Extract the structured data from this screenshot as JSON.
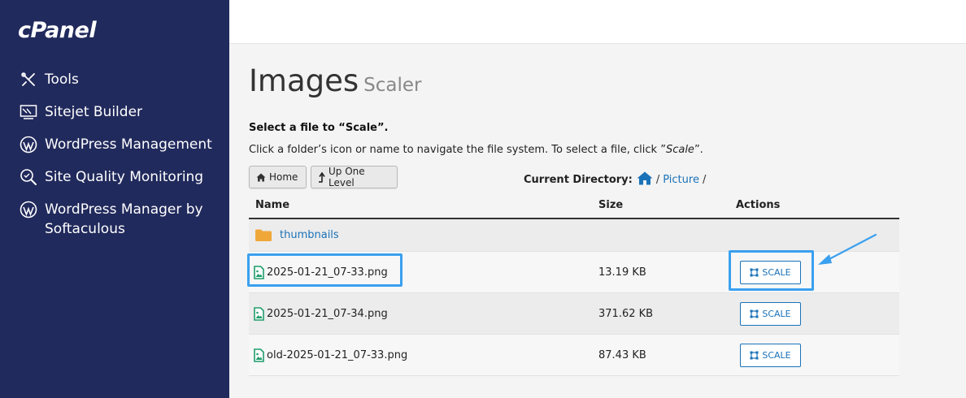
{
  "app": {
    "logo": "cPanel"
  },
  "sidebar": {
    "items": [
      {
        "label": "Tools",
        "icon": "tools-icon"
      },
      {
        "label": "Sitejet Builder",
        "icon": "sitejet-icon"
      },
      {
        "label": "WordPress Management",
        "icon": "wordpress-icon"
      },
      {
        "label": "Site Quality Monitoring",
        "icon": "quality-search-icon"
      },
      {
        "label": "WordPress Manager by Softaculous",
        "icon": "wordpress-icon"
      }
    ]
  },
  "page": {
    "title": "Images",
    "subtitle": "Scaler",
    "instruction": "Select a file to “Scale”.",
    "help_prefix": "Click a folder’s icon or name to navigate the file system. To select a file, click ”",
    "help_emphasis": "Scale",
    "help_suffix": "”."
  },
  "toolbar": {
    "home_label": "Home",
    "up_label": "Up One Level"
  },
  "current_directory": {
    "label": "Current Directory:",
    "path_separator": "/",
    "folder": "Picture",
    "trailing": "/"
  },
  "table": {
    "headers": {
      "name": "Name",
      "size": "Size",
      "actions": "Actions"
    },
    "folder_row": {
      "name": "thumbnails"
    },
    "rows": [
      {
        "name": "2025-01-21_07-33.png",
        "size": "13.19 KB",
        "action": "SCALE"
      },
      {
        "name": "2025-01-21_07-34.png",
        "size": "371.62 KB",
        "action": "SCALE"
      },
      {
        "name": "old-2025-01-21_07-33.png",
        "size": "87.43 KB",
        "action": "SCALE"
      }
    ]
  },
  "colors": {
    "sidebar_bg": "#212a5c",
    "link": "#1a72b8",
    "highlight": "#3aa0ef",
    "file_icon": "#1f9d6b",
    "folder_icon": "#f0a73a"
  }
}
